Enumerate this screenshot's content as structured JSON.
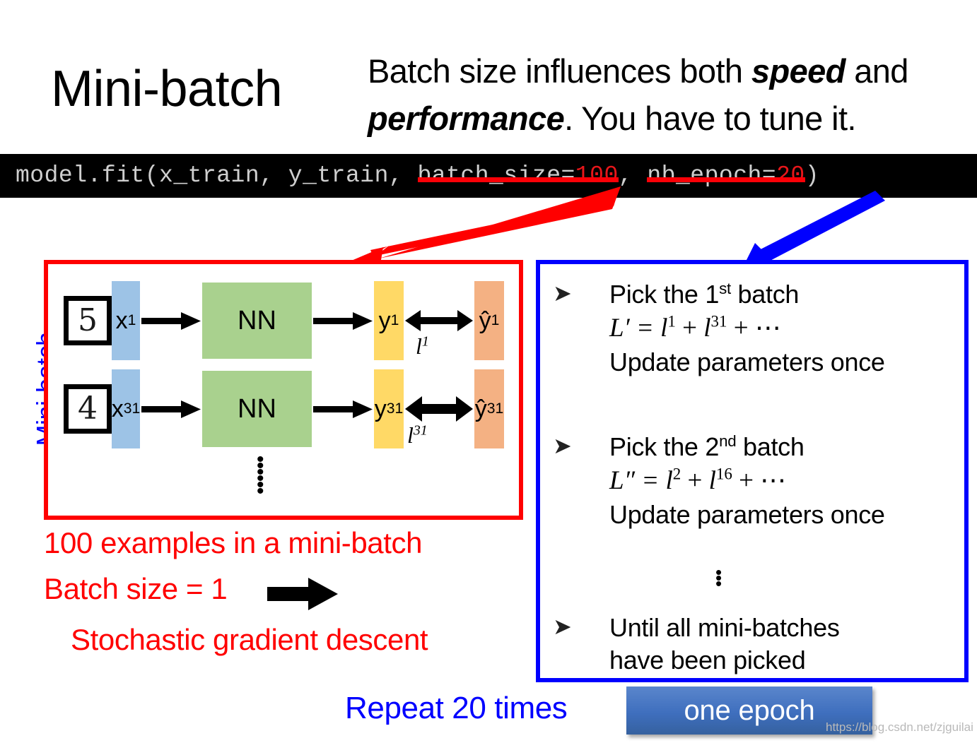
{
  "slide": {
    "title": "Mini-batch",
    "headline": {
      "part1": "Batch size influences both ",
      "bold1": "speed",
      "part2": " and ",
      "bold2": "performance",
      "part3": ". You have to tune it."
    }
  },
  "code": {
    "prefix": "model.fit(x_train, y_train, ",
    "arg1_key": "batch_size=",
    "arg1_val": "100",
    "separator": ", ",
    "arg2_key": "nb_epoch=",
    "arg2_val": "20",
    "suffix": ")"
  },
  "left_label": "Mini-batch",
  "diagram": {
    "rows": [
      {
        "digit": "5",
        "input": "x",
        "input_sup": "1",
        "nn": "NN",
        "output": "y",
        "output_sup": "1",
        "target": "ŷ",
        "target_sup": "1",
        "loss": "l",
        "loss_sup": "1"
      },
      {
        "digit": "4",
        "input": "x",
        "input_sup": "31",
        "nn": "NN",
        "output": "y",
        "output_sup": "31",
        "target": "ŷ",
        "target_sup": "31",
        "loss": "l",
        "loss_sup": "31"
      }
    ],
    "continuation_dots": "⋮"
  },
  "red_notes": {
    "examples": "100 examples in a mini-batch",
    "batch_size_one": "Batch size = 1",
    "sgd": "Stochastic gradient descent"
  },
  "blue_box": {
    "bullets": [
      {
        "marker": "➤",
        "heading_prefix": "Pick the 1",
        "heading_ordinal": "st",
        "heading_suffix": " batch",
        "formula_lhs": "L′ = ",
        "formula_t1": "l",
        "formula_t1_sup": "1",
        "formula_plus1": " + ",
        "formula_t2": "l",
        "formula_t2_sup": "31",
        "formula_plus2": " + ⋯",
        "note": "Update parameters once"
      },
      {
        "marker": "➤",
        "heading_prefix": "Pick the 2",
        "heading_ordinal": "nd",
        "heading_suffix": " batch",
        "formula_lhs": "L″ = ",
        "formula_t1": "l",
        "formula_t1_sup": "2",
        "formula_plus1": " + ",
        "formula_t2": "l",
        "formula_t2_sup": "16",
        "formula_plus2": " + ⋯",
        "note": "Update parameters once"
      },
      {
        "marker": "➤",
        "line1": "Until all mini-batches",
        "line2": "have been picked"
      }
    ],
    "middle_dots": "⋮"
  },
  "footer": {
    "repeat": "Repeat 20 times",
    "epoch_badge": "one epoch",
    "watermark": "https://blog.csdn.net/zjguilai"
  },
  "colors": {
    "red": "#ff0000",
    "blue": "#0000ff",
    "input_box": "#9dc3e6",
    "nn_box": "#a9d18e",
    "output_box": "#ffd966",
    "target_box": "#f4b183",
    "code_bg": "#000000",
    "code_text": "#cfcfcf",
    "code_value": "#e8161a",
    "badge": "#3f6fbe"
  }
}
